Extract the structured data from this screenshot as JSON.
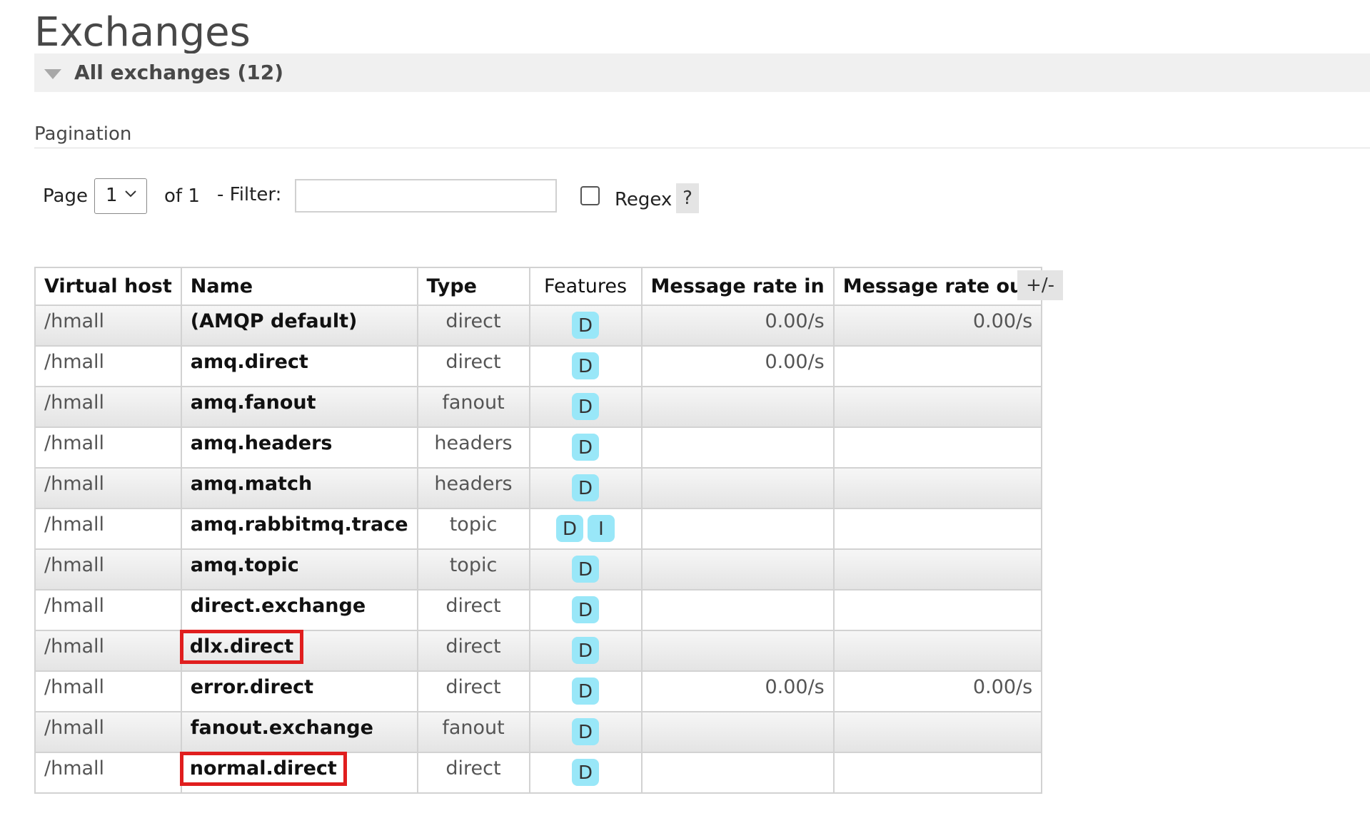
{
  "page": {
    "title": "Exchanges"
  },
  "section": {
    "label": "All exchanges (12)"
  },
  "pagination": {
    "title": "Pagination",
    "page_label": "Page",
    "page_value": "1",
    "of_label": "of 1",
    "filter_label": "- Filter:",
    "filter_value": "",
    "regex_label": "Regex",
    "help_label": "?"
  },
  "table": {
    "columns": [
      "Virtual host",
      "Name",
      "Type",
      "Features",
      "Message rate in",
      "Message rate out"
    ],
    "toggle_label": "+/-",
    "rows": [
      {
        "vhost": "/hmall",
        "name": "(AMQP default)",
        "type": "direct",
        "features": [
          "D"
        ],
        "rate_in": "0.00/s",
        "rate_out": "0.00/s",
        "highlighted": false
      },
      {
        "vhost": "/hmall",
        "name": "amq.direct",
        "type": "direct",
        "features": [
          "D"
        ],
        "rate_in": "0.00/s",
        "rate_out": "",
        "highlighted": false
      },
      {
        "vhost": "/hmall",
        "name": "amq.fanout",
        "type": "fanout",
        "features": [
          "D"
        ],
        "rate_in": "",
        "rate_out": "",
        "highlighted": false
      },
      {
        "vhost": "/hmall",
        "name": "amq.headers",
        "type": "headers",
        "features": [
          "D"
        ],
        "rate_in": "",
        "rate_out": "",
        "highlighted": false
      },
      {
        "vhost": "/hmall",
        "name": "amq.match",
        "type": "headers",
        "features": [
          "D"
        ],
        "rate_in": "",
        "rate_out": "",
        "highlighted": false
      },
      {
        "vhost": "/hmall",
        "name": "amq.rabbitmq.trace",
        "type": "topic",
        "features": [
          "D",
          "I"
        ],
        "rate_in": "",
        "rate_out": "",
        "highlighted": false
      },
      {
        "vhost": "/hmall",
        "name": "amq.topic",
        "type": "topic",
        "features": [
          "D"
        ],
        "rate_in": "",
        "rate_out": "",
        "highlighted": false
      },
      {
        "vhost": "/hmall",
        "name": "direct.exchange",
        "type": "direct",
        "features": [
          "D"
        ],
        "rate_in": "",
        "rate_out": "",
        "highlighted": false
      },
      {
        "vhost": "/hmall",
        "name": "dlx.direct",
        "type": "direct",
        "features": [
          "D"
        ],
        "rate_in": "",
        "rate_out": "",
        "highlighted": true
      },
      {
        "vhost": "/hmall",
        "name": "error.direct",
        "type": "direct",
        "features": [
          "D"
        ],
        "rate_in": "0.00/s",
        "rate_out": "0.00/s",
        "highlighted": false
      },
      {
        "vhost": "/hmall",
        "name": "fanout.exchange",
        "type": "fanout",
        "features": [
          "D"
        ],
        "rate_in": "",
        "rate_out": "",
        "highlighted": false
      },
      {
        "vhost": "/hmall",
        "name": "normal.direct",
        "type": "direct",
        "features": [
          "D"
        ],
        "rate_in": "",
        "rate_out": "",
        "highlighted": true
      }
    ]
  },
  "colors": {
    "badge": "#99e7f8",
    "highlight_border": "#e01e1e",
    "section_bar": "#f0f0f0"
  },
  "icons": {
    "collapse": "triangle-down-icon",
    "select": "chevron-down-icon"
  }
}
